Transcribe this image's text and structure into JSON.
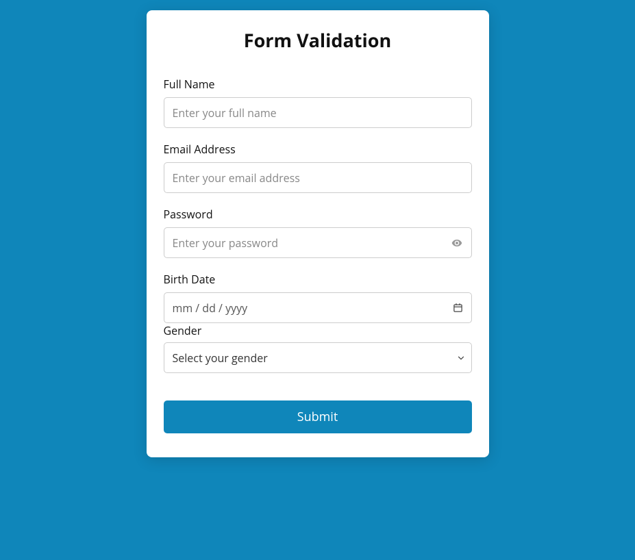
{
  "title": "Form Validation",
  "fields": {
    "fullname": {
      "label": "Full Name",
      "placeholder": "Enter your full name",
      "value": ""
    },
    "email": {
      "label": "Email Address",
      "placeholder": "Enter your email address",
      "value": ""
    },
    "password": {
      "label": "Password",
      "placeholder": "Enter your password",
      "value": ""
    },
    "birthdate": {
      "label": "Birth Date",
      "placeholder": "mm / dd / yyyy",
      "value": ""
    },
    "gender": {
      "label": "Gender",
      "selected": "Select your gender"
    }
  },
  "submit": {
    "label": "Submit"
  }
}
